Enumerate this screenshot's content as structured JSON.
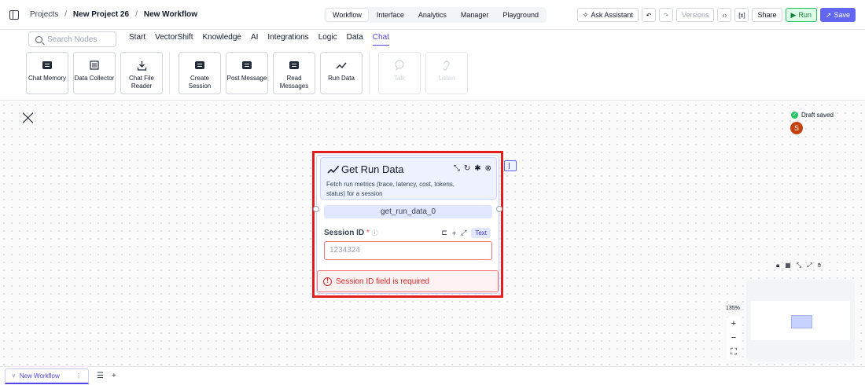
{
  "breadcrumb": {
    "projects": "Projects",
    "project": "New Project 26",
    "workflow": "New Workflow",
    "sep": "/"
  },
  "center_tabs": [
    "Workflow",
    "Interface",
    "Analytics",
    "Manager",
    "Playground"
  ],
  "active_center_tab": "Workflow",
  "actions": {
    "ask_assistant": "Ask Assistant",
    "versions": "Versions",
    "share": "Share",
    "run": "Run",
    "save": "Save"
  },
  "search": {
    "placeholder": "Search Nodes"
  },
  "category_tabs": [
    "Start",
    "VectorShift",
    "Knowledge",
    "AI",
    "Integrations",
    "Logic",
    "Data",
    "Chat"
  ],
  "active_category": "Chat",
  "node_palette": [
    {
      "label": "Chat Memory",
      "icon": "chat-icon",
      "disabled": false
    },
    {
      "label": "Data Collector",
      "icon": "list-icon",
      "disabled": false
    },
    {
      "label": "Chat File Reader",
      "icon": "download-icon",
      "disabled": false
    },
    {
      "label": "Create Session",
      "icon": "chat-icon",
      "disabled": false
    },
    {
      "label": "Post Message",
      "icon": "chat-icon",
      "disabled": false
    },
    {
      "label": "Read Messages",
      "icon": "chat-icon",
      "disabled": false
    },
    {
      "label": "Run Data",
      "icon": "trend-icon",
      "disabled": false
    },
    {
      "label": "Talk",
      "icon": "speech-icon",
      "disabled": true
    },
    {
      "label": "Listen",
      "icon": "ear-icon",
      "disabled": true
    }
  ],
  "status": {
    "draft": "Draft saved",
    "avatar_initial": "S"
  },
  "node": {
    "title": "Get Run Data",
    "description": "Fetch run metrics (trace, latency, cost, tokens, status) for a session",
    "name": "get_run_data_0",
    "field_label": "Session ID",
    "field_required": "*",
    "field_type": "Text",
    "field_placeholder": "1234324",
    "error": "Session ID field is required"
  },
  "zoom": {
    "level": "135%",
    "in": "+",
    "out": "−"
  },
  "bottom": {
    "workflow_tab": "New Workflow",
    "add": "+"
  },
  "colors": {
    "accent": "#4f46e5",
    "error": "#dc2626",
    "highlight": "#e11d1d",
    "run": "#22c55e"
  }
}
